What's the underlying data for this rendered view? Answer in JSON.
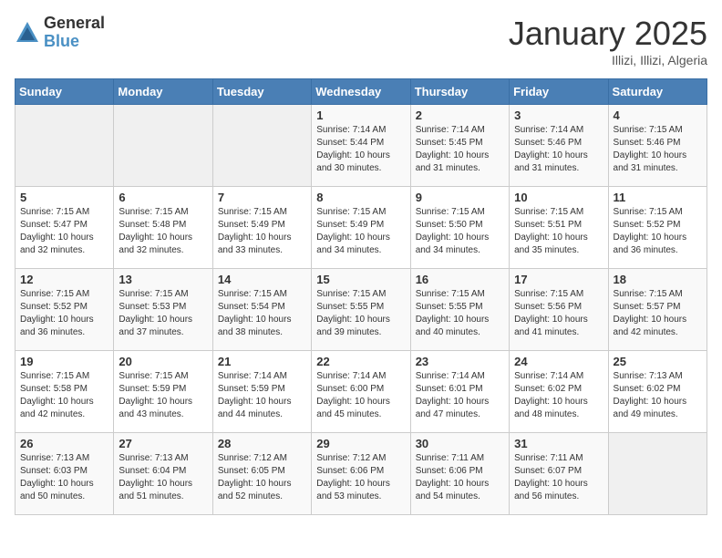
{
  "logo": {
    "general": "General",
    "blue": "Blue"
  },
  "header": {
    "month": "January 2025",
    "location": "Illizi, Illizi, Algeria"
  },
  "weekdays": [
    "Sunday",
    "Monday",
    "Tuesday",
    "Wednesday",
    "Thursday",
    "Friday",
    "Saturday"
  ],
  "weeks": [
    [
      {
        "day": "",
        "info": ""
      },
      {
        "day": "",
        "info": ""
      },
      {
        "day": "",
        "info": ""
      },
      {
        "day": "1",
        "info": "Sunrise: 7:14 AM\nSunset: 5:44 PM\nDaylight: 10 hours\nand 30 minutes."
      },
      {
        "day": "2",
        "info": "Sunrise: 7:14 AM\nSunset: 5:45 PM\nDaylight: 10 hours\nand 31 minutes."
      },
      {
        "day": "3",
        "info": "Sunrise: 7:14 AM\nSunset: 5:46 PM\nDaylight: 10 hours\nand 31 minutes."
      },
      {
        "day": "4",
        "info": "Sunrise: 7:15 AM\nSunset: 5:46 PM\nDaylight: 10 hours\nand 31 minutes."
      }
    ],
    [
      {
        "day": "5",
        "info": "Sunrise: 7:15 AM\nSunset: 5:47 PM\nDaylight: 10 hours\nand 32 minutes."
      },
      {
        "day": "6",
        "info": "Sunrise: 7:15 AM\nSunset: 5:48 PM\nDaylight: 10 hours\nand 32 minutes."
      },
      {
        "day": "7",
        "info": "Sunrise: 7:15 AM\nSunset: 5:49 PM\nDaylight: 10 hours\nand 33 minutes."
      },
      {
        "day": "8",
        "info": "Sunrise: 7:15 AM\nSunset: 5:49 PM\nDaylight: 10 hours\nand 34 minutes."
      },
      {
        "day": "9",
        "info": "Sunrise: 7:15 AM\nSunset: 5:50 PM\nDaylight: 10 hours\nand 34 minutes."
      },
      {
        "day": "10",
        "info": "Sunrise: 7:15 AM\nSunset: 5:51 PM\nDaylight: 10 hours\nand 35 minutes."
      },
      {
        "day": "11",
        "info": "Sunrise: 7:15 AM\nSunset: 5:52 PM\nDaylight: 10 hours\nand 36 minutes."
      }
    ],
    [
      {
        "day": "12",
        "info": "Sunrise: 7:15 AM\nSunset: 5:52 PM\nDaylight: 10 hours\nand 36 minutes."
      },
      {
        "day": "13",
        "info": "Sunrise: 7:15 AM\nSunset: 5:53 PM\nDaylight: 10 hours\nand 37 minutes."
      },
      {
        "day": "14",
        "info": "Sunrise: 7:15 AM\nSunset: 5:54 PM\nDaylight: 10 hours\nand 38 minutes."
      },
      {
        "day": "15",
        "info": "Sunrise: 7:15 AM\nSunset: 5:55 PM\nDaylight: 10 hours\nand 39 minutes."
      },
      {
        "day": "16",
        "info": "Sunrise: 7:15 AM\nSunset: 5:55 PM\nDaylight: 10 hours\nand 40 minutes."
      },
      {
        "day": "17",
        "info": "Sunrise: 7:15 AM\nSunset: 5:56 PM\nDaylight: 10 hours\nand 41 minutes."
      },
      {
        "day": "18",
        "info": "Sunrise: 7:15 AM\nSunset: 5:57 PM\nDaylight: 10 hours\nand 42 minutes."
      }
    ],
    [
      {
        "day": "19",
        "info": "Sunrise: 7:15 AM\nSunset: 5:58 PM\nDaylight: 10 hours\nand 42 minutes."
      },
      {
        "day": "20",
        "info": "Sunrise: 7:15 AM\nSunset: 5:59 PM\nDaylight: 10 hours\nand 43 minutes."
      },
      {
        "day": "21",
        "info": "Sunrise: 7:14 AM\nSunset: 5:59 PM\nDaylight: 10 hours\nand 44 minutes."
      },
      {
        "day": "22",
        "info": "Sunrise: 7:14 AM\nSunset: 6:00 PM\nDaylight: 10 hours\nand 45 minutes."
      },
      {
        "day": "23",
        "info": "Sunrise: 7:14 AM\nSunset: 6:01 PM\nDaylight: 10 hours\nand 47 minutes."
      },
      {
        "day": "24",
        "info": "Sunrise: 7:14 AM\nSunset: 6:02 PM\nDaylight: 10 hours\nand 48 minutes."
      },
      {
        "day": "25",
        "info": "Sunrise: 7:13 AM\nSunset: 6:02 PM\nDaylight: 10 hours\nand 49 minutes."
      }
    ],
    [
      {
        "day": "26",
        "info": "Sunrise: 7:13 AM\nSunset: 6:03 PM\nDaylight: 10 hours\nand 50 minutes."
      },
      {
        "day": "27",
        "info": "Sunrise: 7:13 AM\nSunset: 6:04 PM\nDaylight: 10 hours\nand 51 minutes."
      },
      {
        "day": "28",
        "info": "Sunrise: 7:12 AM\nSunset: 6:05 PM\nDaylight: 10 hours\nand 52 minutes."
      },
      {
        "day": "29",
        "info": "Sunrise: 7:12 AM\nSunset: 6:06 PM\nDaylight: 10 hours\nand 53 minutes."
      },
      {
        "day": "30",
        "info": "Sunrise: 7:11 AM\nSunset: 6:06 PM\nDaylight: 10 hours\nand 54 minutes."
      },
      {
        "day": "31",
        "info": "Sunrise: 7:11 AM\nSunset: 6:07 PM\nDaylight: 10 hours\nand 56 minutes."
      },
      {
        "day": "",
        "info": ""
      }
    ]
  ]
}
